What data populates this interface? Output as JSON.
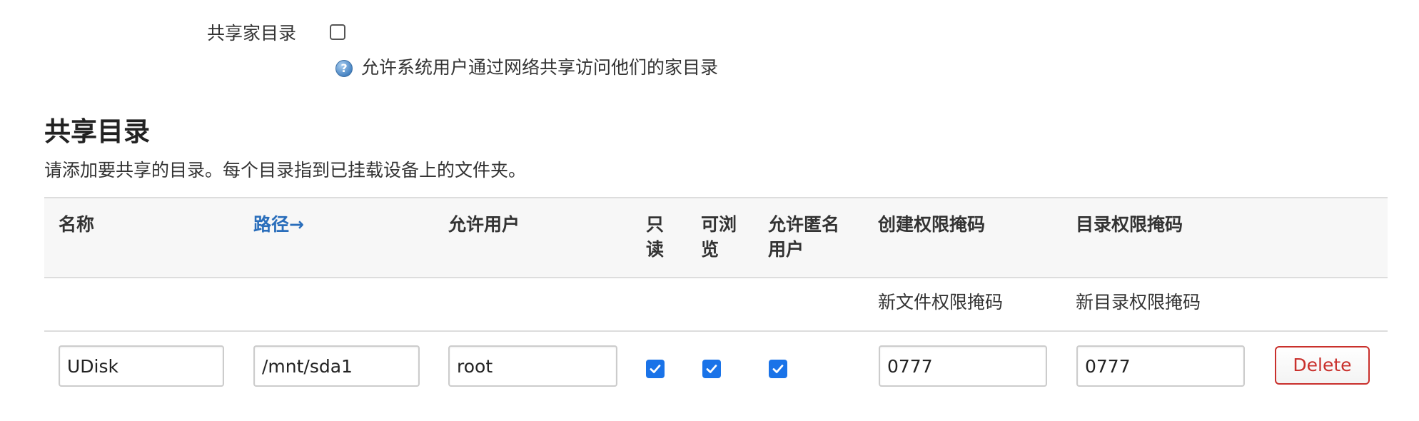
{
  "home_share": {
    "label": "共享家目录",
    "checked": false,
    "help_text": "允许系统用户通过网络共享访问他们的家目录"
  },
  "section": {
    "title": "共享目录",
    "description": "请添加要共享的目录。每个目录指到已挂载设备上的文件夹。"
  },
  "table": {
    "headers": {
      "name": "名称",
      "path": "路径→",
      "users": "允许用户",
      "readonly_1": "只",
      "readonly_2": "读",
      "browseable_1": "可浏",
      "browseable_2": "览",
      "guest_1": "允许匿名",
      "guest_2": "用户",
      "create_mask": "创建权限掩码",
      "dir_mask": "目录权限掩码"
    },
    "subheaders": {
      "create_mask": "新文件权限掩码",
      "dir_mask": "新目录权限掩码"
    },
    "rows": [
      {
        "name": "UDisk",
        "path": "/mnt/sda1",
        "users": "root",
        "read_only": true,
        "browseable": true,
        "guest_ok": true,
        "create_mask": "0777",
        "dir_mask": "0777",
        "delete_label": "Delete"
      }
    ]
  },
  "colors": {
    "link": "#2a6ebb",
    "checkbox": "#1a73e8",
    "delete": "#c9302c"
  }
}
